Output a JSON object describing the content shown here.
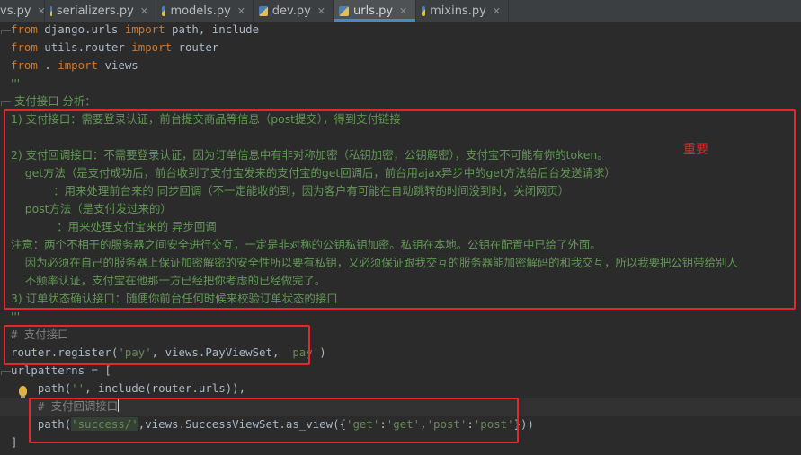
{
  "tabs": [
    {
      "label": "vs.py",
      "active": false
    },
    {
      "label": "serializers.py",
      "active": false
    },
    {
      "label": "models.py",
      "active": false
    },
    {
      "label": "dev.py",
      "active": false
    },
    {
      "label": "urls.py",
      "active": true
    },
    {
      "label": "mixins.py",
      "active": false
    }
  ],
  "code": {
    "l1": {
      "k1": "from",
      "t1": " django.urls ",
      "k2": "import",
      "t2": " path, include"
    },
    "l2": {
      "k1": "from",
      "t1": " utils.router ",
      "k2": "import",
      "t2": " router"
    },
    "l3": {
      "k1": "from",
      "t1": " . ",
      "k2": "import",
      "t2": " views"
    },
    "l4": "'''",
    "l5": " 支付接口 分析：",
    "l6": "1) 支付接口：需要登录认证，前台提交商品等信息（post提交），得到支付链接",
    "l8": "2) 支付回调接口：不需要登录认证，因为订单信息中有非对称加密（私钥加密，公钥解密），支付宝不可能有你的token。",
    "l9": "    get方法（是支付成功后，前台收到了支付宝发来的支付宝的get回调后，前台用ajax异步中的get方法给后台发送请求）",
    "l10": "            ：用来处理前台来的 同步回调（不一定能收的到，因为客户有可能在自动跳转的时间没到时，关闭网页）",
    "l11": "    post方法（是支付发过来的）",
    "l12": "             ：用来处理支付宝来的 异步回调",
    "l13": "注意：两个不相干的服务器之间安全进行交互，一定是非对称的公钥私钥加密。私钥在本地。公钥在配置中已给了外面。",
    "l14": "    因为必须在自己的服务器上保证加密解密的安全性所以要有私钥，又必须保证跟我交互的服务器能加密解码的和我交互，所以我要把公钥带给别人",
    "l15": "    不频率认证，支付宝在他那一方已经把你考虑的已经做完了。",
    "l16": "3) 订单状态确认接口：随便你前台任何时候来校验订单状态的接口",
    "l17": "'''",
    "l18": "# 支付接口",
    "l19": {
      "t1": "router.register(",
      "s1": "'pay'",
      "t2": ", views.PayViewSet, ",
      "s2": "'pay'",
      "t3": ")"
    },
    "l20": "urlpatterns = [",
    "l21": {
      "t1": "    path(",
      "s1": "''",
      "t2": ", include(router.urls)),"
    },
    "l22": "    # 支付回调接口",
    "l23": {
      "t1": "    path(",
      "s1": "'success/'",
      "t2": ",views.SuccessViewSet.as_view({",
      "s2": "'get'",
      "c1": ":",
      "s3": "'get'",
      "c2": ",",
      "s4": "'post'",
      "c3": ":",
      "s5": "'post'",
      "t3": "}))"
    },
    "l24": "]"
  },
  "annotation": {
    "label": "重要",
    "color": "#e5262b"
  }
}
